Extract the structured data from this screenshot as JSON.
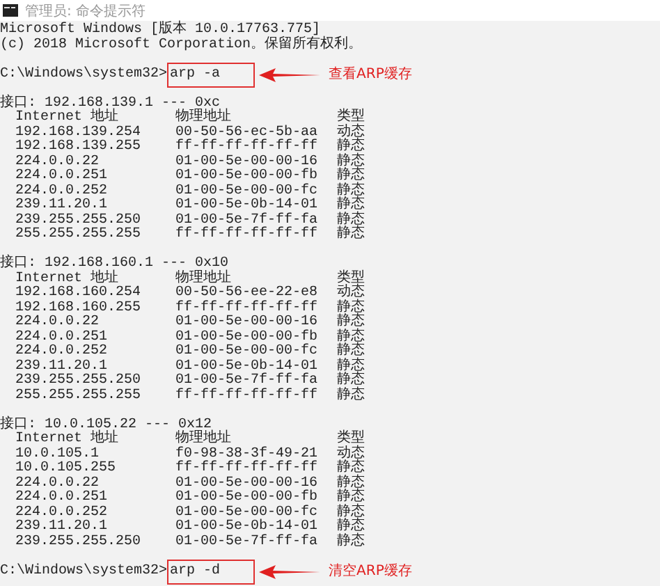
{
  "window": {
    "title": "管理员: 命令提示符"
  },
  "banner": [
    "Microsoft Windows [版本 10.0.17763.775]",
    "(c) 2018 Microsoft Corporation。保留所有权利。"
  ],
  "blocks": [
    {
      "kind": "prompt",
      "prompt": "C:\\Windows\\system32>",
      "command": "arp -a",
      "note": "查看ARP缓存"
    },
    {
      "kind": "interface",
      "title": "接口: 192.168.139.1 --- 0xc",
      "columns": [
        "Internet 地址",
        "物理地址",
        "类型"
      ],
      "rows": [
        [
          "192.168.139.254",
          "00-50-56-ec-5b-aa",
          "动态"
        ],
        [
          "192.168.139.255",
          "ff-ff-ff-ff-ff-ff",
          "静态"
        ],
        [
          "224.0.0.22",
          "01-00-5e-00-00-16",
          "静态"
        ],
        [
          "224.0.0.251",
          "01-00-5e-00-00-fb",
          "静态"
        ],
        [
          "224.0.0.252",
          "01-00-5e-00-00-fc",
          "静态"
        ],
        [
          "239.11.20.1",
          "01-00-5e-0b-14-01",
          "静态"
        ],
        [
          "239.255.255.250",
          "01-00-5e-7f-ff-fa",
          "静态"
        ],
        [
          "255.255.255.255",
          "ff-ff-ff-ff-ff-ff",
          "静态"
        ]
      ]
    },
    {
      "kind": "interface",
      "title": "接口: 192.168.160.1 --- 0x10",
      "columns": [
        "Internet 地址",
        "物理地址",
        "类型"
      ],
      "rows": [
        [
          "192.168.160.254",
          "00-50-56-ee-22-e8",
          "动态"
        ],
        [
          "192.168.160.255",
          "ff-ff-ff-ff-ff-ff",
          "静态"
        ],
        [
          "224.0.0.22",
          "01-00-5e-00-00-16",
          "静态"
        ],
        [
          "224.0.0.251",
          "01-00-5e-00-00-fb",
          "静态"
        ],
        [
          "224.0.0.252",
          "01-00-5e-00-00-fc",
          "静态"
        ],
        [
          "239.11.20.1",
          "01-00-5e-0b-14-01",
          "静态"
        ],
        [
          "239.255.255.250",
          "01-00-5e-7f-ff-fa",
          "静态"
        ],
        [
          "255.255.255.255",
          "ff-ff-ff-ff-ff-ff",
          "静态"
        ]
      ]
    },
    {
      "kind": "interface",
      "title": "接口: 10.0.105.22 --- 0x12",
      "columns": [
        "Internet 地址",
        "物理地址",
        "类型"
      ],
      "rows": [
        [
          "10.0.105.1",
          "f0-98-38-3f-49-21",
          "动态"
        ],
        [
          "10.0.105.255",
          "ff-ff-ff-ff-ff-ff",
          "静态"
        ],
        [
          "224.0.0.22",
          "01-00-5e-00-00-16",
          "静态"
        ],
        [
          "224.0.0.251",
          "01-00-5e-00-00-fb",
          "静态"
        ],
        [
          "224.0.0.252",
          "01-00-5e-00-00-fc",
          "静态"
        ],
        [
          "239.11.20.1",
          "01-00-5e-0b-14-01",
          "静态"
        ],
        [
          "239.255.255.250",
          "01-00-5e-7f-ff-fa",
          "静态"
        ]
      ]
    },
    {
      "kind": "prompt",
      "prompt": "C:\\Windows\\system32>",
      "command": "arp -d",
      "note": "清空ARP缓存"
    }
  ]
}
